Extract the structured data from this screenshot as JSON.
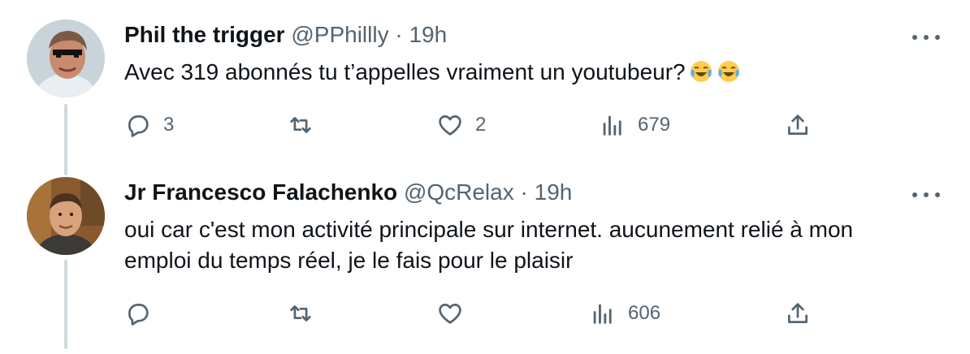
{
  "tweets": [
    {
      "name": "Phil the trigger",
      "handle": "@PPhillly",
      "separator": "·",
      "time": "19h",
      "text": "Avec 319 abonnés tu t’appelles vraiment un youtubeur?",
      "emojis": [
        "face-with-tears-of-joy",
        "face-with-tears-of-joy"
      ],
      "reply_count": "3",
      "retweet_count": "",
      "like_count": "2",
      "view_count": "679"
    },
    {
      "name": "Jr Francesco Falachenko",
      "handle": "@QcRelax",
      "separator": "·",
      "time": "19h",
      "text_lines": [
        "oui car c'est mon activité principale sur internet. aucunement relié à mon",
        "emploi du temps réel, je le fais pour le plaisir"
      ],
      "reply_count": "",
      "retweet_count": "",
      "like_count": "",
      "view_count": "606"
    }
  ],
  "colors": {
    "text": "#0f1419",
    "secondary": "#536471",
    "thread_line": "#cfd9de"
  }
}
